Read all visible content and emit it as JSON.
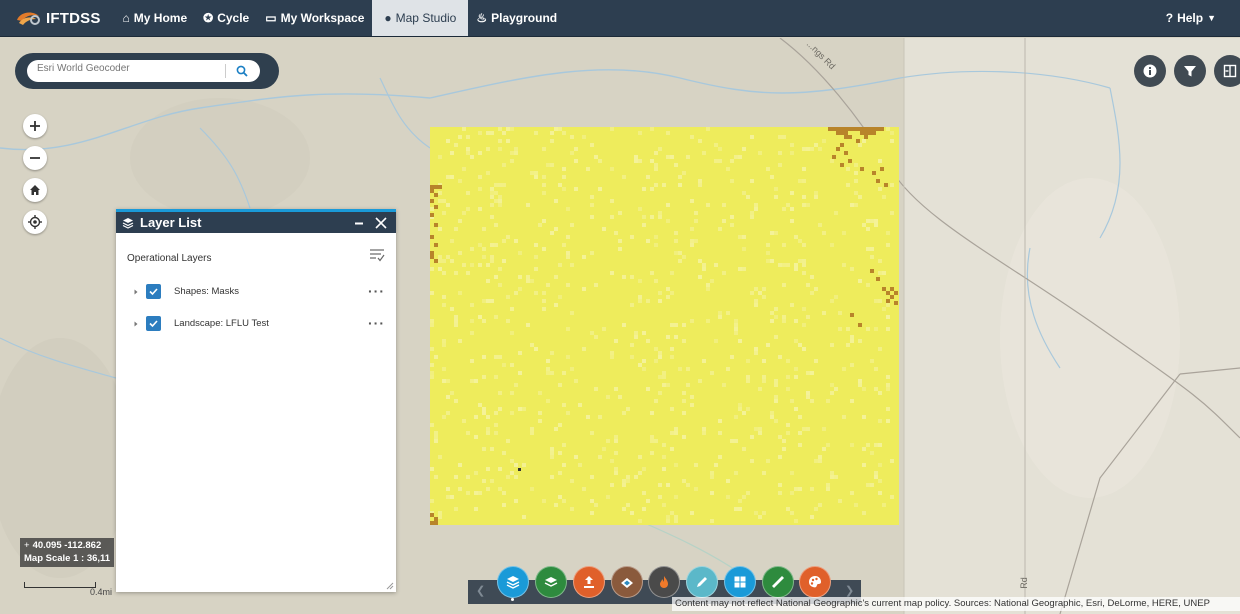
{
  "nav": {
    "brand": "IFTDSS",
    "items": [
      {
        "label": "My Home",
        "icon": "home-icon"
      },
      {
        "label": "Cycle",
        "icon": "cycle-icon"
      },
      {
        "label": "My Workspace",
        "icon": "workspace-icon"
      },
      {
        "label": "Map Studio",
        "icon": "globe-icon",
        "active": true
      },
      {
        "label": "Playground",
        "icon": "flame-icon"
      }
    ],
    "help": "Help"
  },
  "search": {
    "placeholder": "Esri World Geocoder"
  },
  "map": {
    "road_label": "...ngs Rd",
    "road_label_2": "Rd"
  },
  "layer_list": {
    "title": "Layer List",
    "section": "Operational Layers",
    "layers": [
      {
        "label": "Shapes: Masks",
        "checked": true
      },
      {
        "label": "Landscape: LFLU Test",
        "checked": true
      }
    ]
  },
  "coords": {
    "latlon": "40.095 -112.862",
    "scale": "Map Scale 1 : 36,11"
  },
  "scale_bar": {
    "label": "0.4mi"
  },
  "attribution": "Content may not reflect National Geographic's current map policy. Sources: National Geographic, Esri, DeLorme, HERE, UNEP",
  "colors": {
    "nav_bg": "#2d3e50",
    "accent": "#1a9ad8",
    "raster": "#eeec5c"
  },
  "dock": {
    "buttons": [
      {
        "icon": "layers-icon",
        "color": "#1a9ad8"
      },
      {
        "icon": "add-layer-icon",
        "color": "#2e8b3e"
      },
      {
        "icon": "upload-icon",
        "color": "#e0602a"
      },
      {
        "icon": "basemap-icon",
        "color": "#8a5a3c"
      },
      {
        "icon": "fire-icon",
        "color": "#4a4a4a"
      },
      {
        "icon": "draw-icon",
        "color": "#5bb8c9"
      },
      {
        "icon": "grid-icon",
        "color": "#1a9ad8"
      },
      {
        "icon": "measure-icon",
        "color": "#2e8b3e"
      },
      {
        "icon": "palette-icon",
        "color": "#e0602a"
      }
    ]
  }
}
